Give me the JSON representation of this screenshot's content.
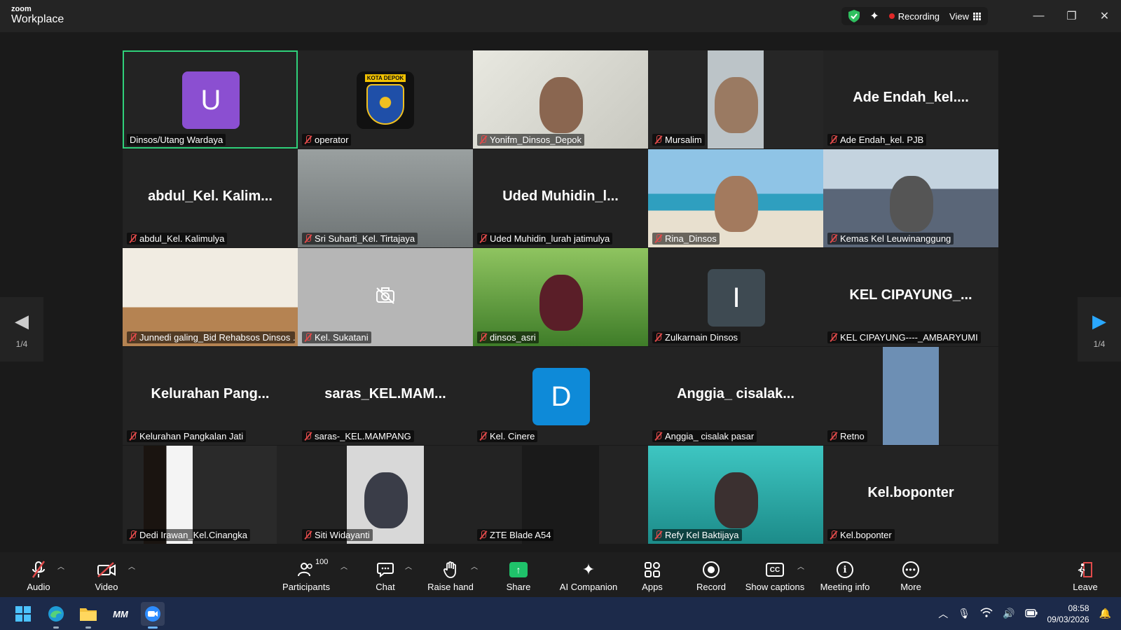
{
  "window": {
    "brand_small": "zoom",
    "brand_big": "Workplace",
    "recording_label": "Recording",
    "view_label": "View",
    "minimize_symbol": "—",
    "restore_symbol": "❐",
    "close_symbol": "✕"
  },
  "colors": {
    "active_border": "#2fd07a",
    "share_green": "#1fc26a",
    "muted_red": "#e04a4a",
    "record_red": "#e02828"
  },
  "pager": {
    "left_page": "1/4",
    "right_page": "1/4"
  },
  "tiles": [
    {
      "name": "Dinsos/Utang Wardaya",
      "kind": "avatar",
      "initial": "U",
      "color": "#8b4fd1"
    },
    {
      "name": "operator",
      "kind": "logo",
      "logo_text": "KOTA DEPOK"
    },
    {
      "name": "Yonifm_Dinsos_Depok",
      "kind": "video"
    },
    {
      "name": "Mursalim",
      "kind": "video"
    },
    {
      "name": "Ade Endah_kel. PJB",
      "kind": "text",
      "display": "Ade  Endah_kel...."
    },
    {
      "name": "abdul_Kel. Kalimulya",
      "kind": "text",
      "display": "abdul_Kel.  Kalim..."
    },
    {
      "name": "Sri Suharti_Kel. Tirtajaya",
      "kind": "video"
    },
    {
      "name": "Uded Muhidin_lurah jatimulya",
      "kind": "text",
      "display": "Uded  Muhidin_l..."
    },
    {
      "name": "Rina_Dinsos",
      "kind": "video"
    },
    {
      "name": "Kemas Kel Leuwinanggung",
      "kind": "video"
    },
    {
      "name": "Junnedi galing_Bid Rehabsos Dinsos ...",
      "kind": "video"
    },
    {
      "name": "Kel. Sukatani",
      "kind": "camoff"
    },
    {
      "name": "dinsos_asri",
      "kind": "video"
    },
    {
      "name": "Zulkarnain Dinsos",
      "kind": "avatar",
      "initial": "I",
      "color": "#3e4a52"
    },
    {
      "name": "KEL CIPAYUNG----_AMBARYUMI",
      "kind": "text",
      "display": "KEL  CIPAYUNG_..."
    },
    {
      "name": "Kelurahan Pangkalan Jati",
      "kind": "text",
      "display": "Kelurahan  Pang..."
    },
    {
      "name": "saras-_KEL.MAMPANG",
      "kind": "text",
      "display": "saras_KEL.MAM..."
    },
    {
      "name": "Kel. Cinere",
      "kind": "avatar",
      "initial": "D",
      "color": "#0e8ad8"
    },
    {
      "name": "Anggia_ cisalak pasar",
      "kind": "text",
      "display": "Anggia_  cisalak..."
    },
    {
      "name": "Retno",
      "kind": "video"
    },
    {
      "name": "Dedi Irawan_Kel.Cinangka",
      "kind": "video"
    },
    {
      "name": "Siti Widayanti",
      "kind": "video"
    },
    {
      "name": "ZTE Blade A54",
      "kind": "video"
    },
    {
      "name": "Refy Kel Baktijaya",
      "kind": "video"
    },
    {
      "name": "Kel.boponter",
      "kind": "text",
      "display": "Kel.boponter"
    }
  ],
  "toolbar": {
    "audio": "Audio",
    "video": "Video",
    "participants": "Participants",
    "participants_count": "100",
    "chat": "Chat",
    "raise_hand": "Raise hand",
    "share": "Share",
    "ai_companion": "AI Companion",
    "apps": "Apps",
    "record": "Record",
    "show_captions": "Show captions",
    "captions_symbol": "CC",
    "meeting_info": "Meeting info",
    "more": "More",
    "leave": "Leave"
  },
  "taskbar": {
    "time": "08:58",
    "date": "09/03/2026",
    "app_mm_label": "MM"
  }
}
